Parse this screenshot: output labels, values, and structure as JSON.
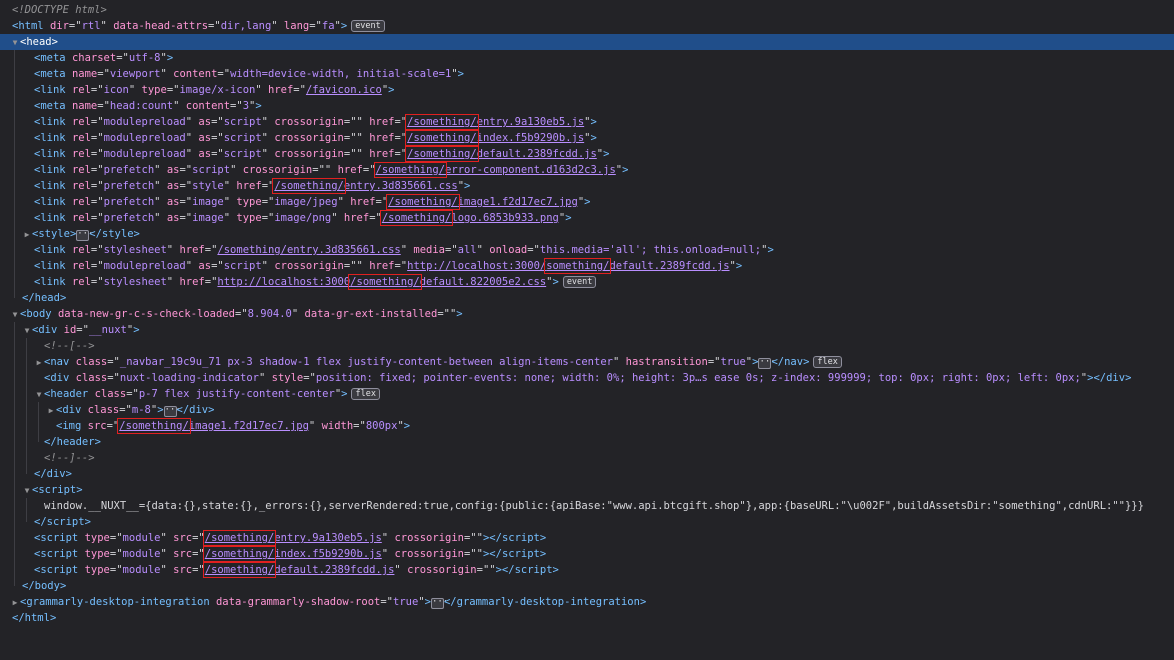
{
  "html_lines": {
    "l01": {
      "doctype": "<!DOCTYPE html>"
    },
    "l02": {
      "tag": "html",
      "a1": "dir",
      "v1": "rtl",
      "a2": "data-head-attrs",
      "v2": "dir,lang",
      "a3": "lang",
      "v3": "fa",
      "badge": "event"
    },
    "l03": {
      "tag": "head"
    },
    "l04": {
      "tag": "meta",
      "a1": "charset",
      "v1": "utf-8"
    },
    "l05": {
      "tag": "meta",
      "a1": "name",
      "v1": "viewport",
      "a2": "content",
      "v2": "width=device-width, initial-scale=1"
    },
    "l06": {
      "tag": "link",
      "a1": "rel",
      "v1": "icon",
      "a2": "type",
      "v2": "image/x-icon",
      "a3": "href",
      "v3": "/favicon.ico"
    },
    "l07": {
      "tag": "meta",
      "a1": "name",
      "v1": "head:count",
      "a2": "content",
      "v2": "3"
    },
    "l08": {
      "tag": "link",
      "a1": "rel",
      "v1": "modulepreload",
      "a2": "as",
      "v2": "script",
      "a3": "crossorigin",
      "v3": "",
      "a4": "href",
      "v4a": "/something/",
      "v4b": "entry.9a130eb5.js"
    },
    "l09": {
      "tag": "link",
      "a1": "rel",
      "v1": "modulepreload",
      "a2": "as",
      "v2": "script",
      "a3": "crossorigin",
      "v3": "",
      "a4": "href",
      "v4a": "/something/",
      "v4b": "index.f5b9290b.js"
    },
    "l10": {
      "tag": "link",
      "a1": "rel",
      "v1": "modulepreload",
      "a2": "as",
      "v2": "script",
      "a3": "crossorigin",
      "v3": "",
      "a4": "href",
      "v4a": "/something/",
      "v4b": "default.2389fcdd.js"
    },
    "l11": {
      "tag": "link",
      "a1": "rel",
      "v1": "prefetch",
      "a2": "as",
      "v2": "script",
      "a3": "crossorigin",
      "v3": "",
      "a4": "href",
      "v4a": "/something/",
      "v4b": "error-component.d163d2c3.js"
    },
    "l12": {
      "tag": "link",
      "a1": "rel",
      "v1": "prefetch",
      "a2": "as",
      "v2": "style",
      "a3": "href",
      "v3a": "/something/",
      "v3b": "entry.3d835661.css"
    },
    "l13": {
      "tag": "link",
      "a1": "rel",
      "v1": "prefetch",
      "a2": "as",
      "v2": "image",
      "a3": "type",
      "v3": "image/jpeg",
      "a4": "href",
      "v4a": "/something/",
      "v4b": "image1.f2d17ec7.jpg"
    },
    "l14": {
      "tag": "link",
      "a1": "rel",
      "v1": "prefetch",
      "a2": "as",
      "v2": "image",
      "a3": "type",
      "v3": "image/png",
      "a4": "href",
      "v4a": "/something/",
      "v4b": "logo.6853b933.png"
    },
    "l15": {
      "tag": "style",
      "close": "/style"
    },
    "l16": {
      "tag": "link",
      "a1": "rel",
      "v1": "stylesheet",
      "a2": "href",
      "v2": "/something/entry.3d835661.css",
      "a3": "media",
      "v3": "all",
      "a4": "onload",
      "v4": "this.media='all'; this.onload=null;"
    },
    "l17": {
      "tag": "link",
      "a1": "rel",
      "v1": "modulepreload",
      "a2": "as",
      "v2": "script",
      "a3": "crossorigin",
      "v3": "",
      "a4": "href",
      "v4a": "http://localhost:3000/",
      "v4b": "something/",
      "v4c": "default.2389fcdd.js"
    },
    "l18": {
      "tag": "link",
      "a1": "rel",
      "v1": "stylesheet",
      "a2": "href",
      "v2a": "http://localhost:3000",
      "v2b": "/something/",
      "v2c": "default.822005e2.css",
      "badge": "event"
    },
    "l19": {
      "close": "/head"
    },
    "l20": {
      "tag": "body",
      "a1": "data-new-gr-c-s-check-loaded",
      "v1": "8.904.0",
      "a2": "data-gr-ext-installed",
      "v2": ""
    },
    "l21": {
      "tag": "div",
      "a1": "id",
      "v1": "__nuxt"
    },
    "l22": {
      "comment": "<!--[-->"
    },
    "l23": {
      "tag": "nav",
      "a1": "class",
      "v1": "_navbar_19c9u_71 px-3 shadow-1 flex justify-content-between align-items-center",
      "a2": "hastransition",
      "v2": "true",
      "close": "/nav",
      "badge": "flex"
    },
    "l24": {
      "tag": "div",
      "a1": "class",
      "v1": "nuxt-loading-indicator",
      "a2": "style",
      "v2": "position: fixed; pointer-events: none; width: 0%; height: 3p…s ease 0s; z-index: 999999; top: 0px; right: 0px; left: 0px;",
      "close": "/div"
    },
    "l25": {
      "tag": "header",
      "a1": "class",
      "v1": "p-7 flex justify-content-center",
      "badge": "flex"
    },
    "l26": {
      "tag": "div",
      "a1": "class",
      "v1": "m-8",
      "close": "/div"
    },
    "l27": {
      "tag": "img",
      "a1": "src",
      "v1a": "/something/",
      "v1b": "image1.f2d17ec7.jpg",
      "a2": "width",
      "v2": "800px"
    },
    "l28": {
      "close": "/header"
    },
    "l29": {
      "comment": "<!--]-->"
    },
    "l30": {
      "close": "/div"
    },
    "l31": {
      "tag": "script"
    },
    "l32": {
      "text": "window.__NUXT__={data:{},state:{},_errors:{},serverRendered:true,config:{public:{apiBase:\"www.api.btcgift.shop\"},app:{baseURL:\"\\u002F\",buildAssetsDir:\"something\",cdnURL:\"\"}}}"
    },
    "l33": {
      "close": "/script"
    },
    "l34": {
      "tag": "script",
      "a1": "type",
      "v1": "module",
      "a2": "src",
      "v2a": "/something/",
      "v2b": "entry.9a130eb5.js",
      "a3": "crossorigin",
      "v3": "",
      "close": "/script"
    },
    "l35": {
      "tag": "script",
      "a1": "type",
      "v1": "module",
      "a2": "src",
      "v2a": "/something/",
      "v2b": "index.f5b9290b.js",
      "a3": "crossorigin",
      "v3": "",
      "close": "/script"
    },
    "l36": {
      "tag": "script",
      "a1": "type",
      "v1": "module",
      "a2": "src",
      "v2a": "/something/",
      "v2b": "default.2389fcdd.js",
      "a3": "crossorigin",
      "v3": "",
      "close": "/script"
    },
    "l37": {
      "close": "/body"
    },
    "l38": {
      "tag": "grammarly-desktop-integration",
      "a1": "data-grammarly-shadow-root",
      "v1": "true",
      "close": "/grammarly-desktop-integration"
    },
    "l39": {
      "close": "/html"
    }
  },
  "icons": {
    "expanded": "chevron-down-icon",
    "collapsed": "chevron-right-icon",
    "collapsed_content": "ellipsis-icon"
  },
  "colors": {
    "background": "#232327",
    "selection": "#204e8a",
    "tag": "#75bfff",
    "attribute": "#ff97d6",
    "value": "#b98eff",
    "highlight_box": "#e02020"
  }
}
